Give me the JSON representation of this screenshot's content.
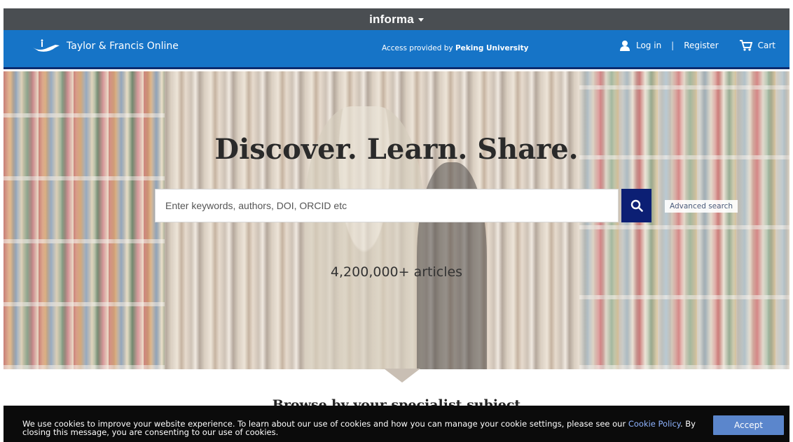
{
  "informa_bar": {
    "brand": "informa"
  },
  "header": {
    "logo_text": "Taylor & Francis Online",
    "access_prefix": "Access provided by",
    "access_institution": "Peking University",
    "login_label": "Log in",
    "separator": "|",
    "register_label": "Register",
    "cart_label": "Cart"
  },
  "hero": {
    "title": "Discover. Learn. Share.",
    "search_placeholder": "Enter keywords, authors, DOI, ORCID etc",
    "advanced_search_label": "Advanced search",
    "articles_count": "4,200,000+ articles"
  },
  "browse": {
    "heading": "Browse by your specialist subject"
  },
  "cookie_banner": {
    "text_before_link": "We use cookies to improve your website experience. To learn about our use of cookies and how you can manage your cookie settings, please see our ",
    "link_text": "Cookie Policy",
    "text_after_link": ". By closing this message, you are consenting to our use of cookies.",
    "accept_label": "Accept"
  },
  "colors": {
    "informa_bar": "#4a4e52",
    "header_blue": "#1674c7",
    "search_button": "#0c1f74",
    "accept_button": "#5b86cc",
    "cookie_link": "#8fb4ff"
  }
}
